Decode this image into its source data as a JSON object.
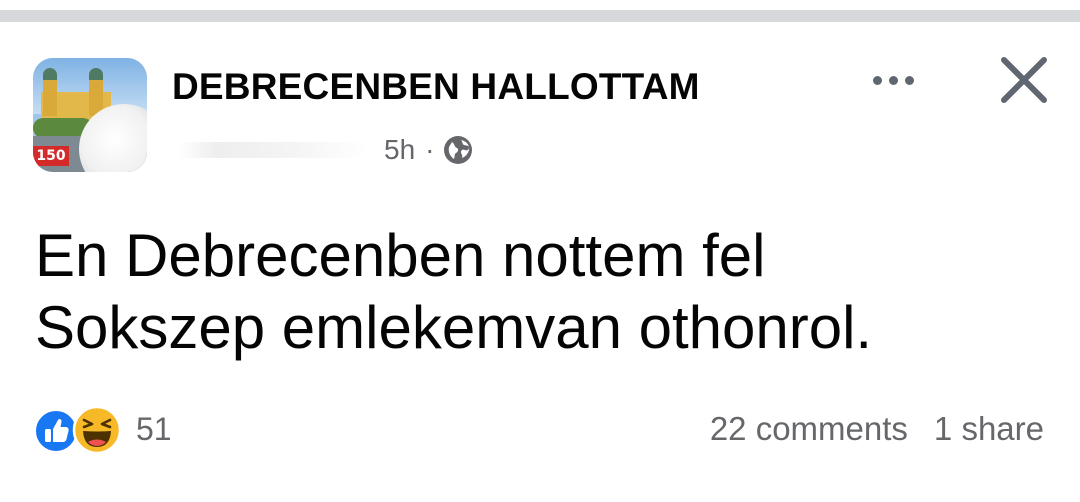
{
  "post": {
    "page_name": "DEBRECENBEN HALLOTTAM",
    "time": "5h",
    "separator": "·",
    "privacy_icon": "globe-icon",
    "avatar_badge": "150",
    "text_lines": [
      "En Debrecenben nottem fel",
      "Sokszep emlekemvan othonrol."
    ],
    "reactions": {
      "icons": [
        "like-icon",
        "haha-icon"
      ],
      "count": "51"
    },
    "comments": "22 comments",
    "shares": "1 share"
  },
  "icons": {
    "more": "more-options-icon",
    "close": "close-icon"
  },
  "colors": {
    "text": "#050505",
    "secondary": "#65676b",
    "like_blue": "#1877f2",
    "haha_yellow": "#f7b928",
    "divider": "#d7d8dc"
  }
}
